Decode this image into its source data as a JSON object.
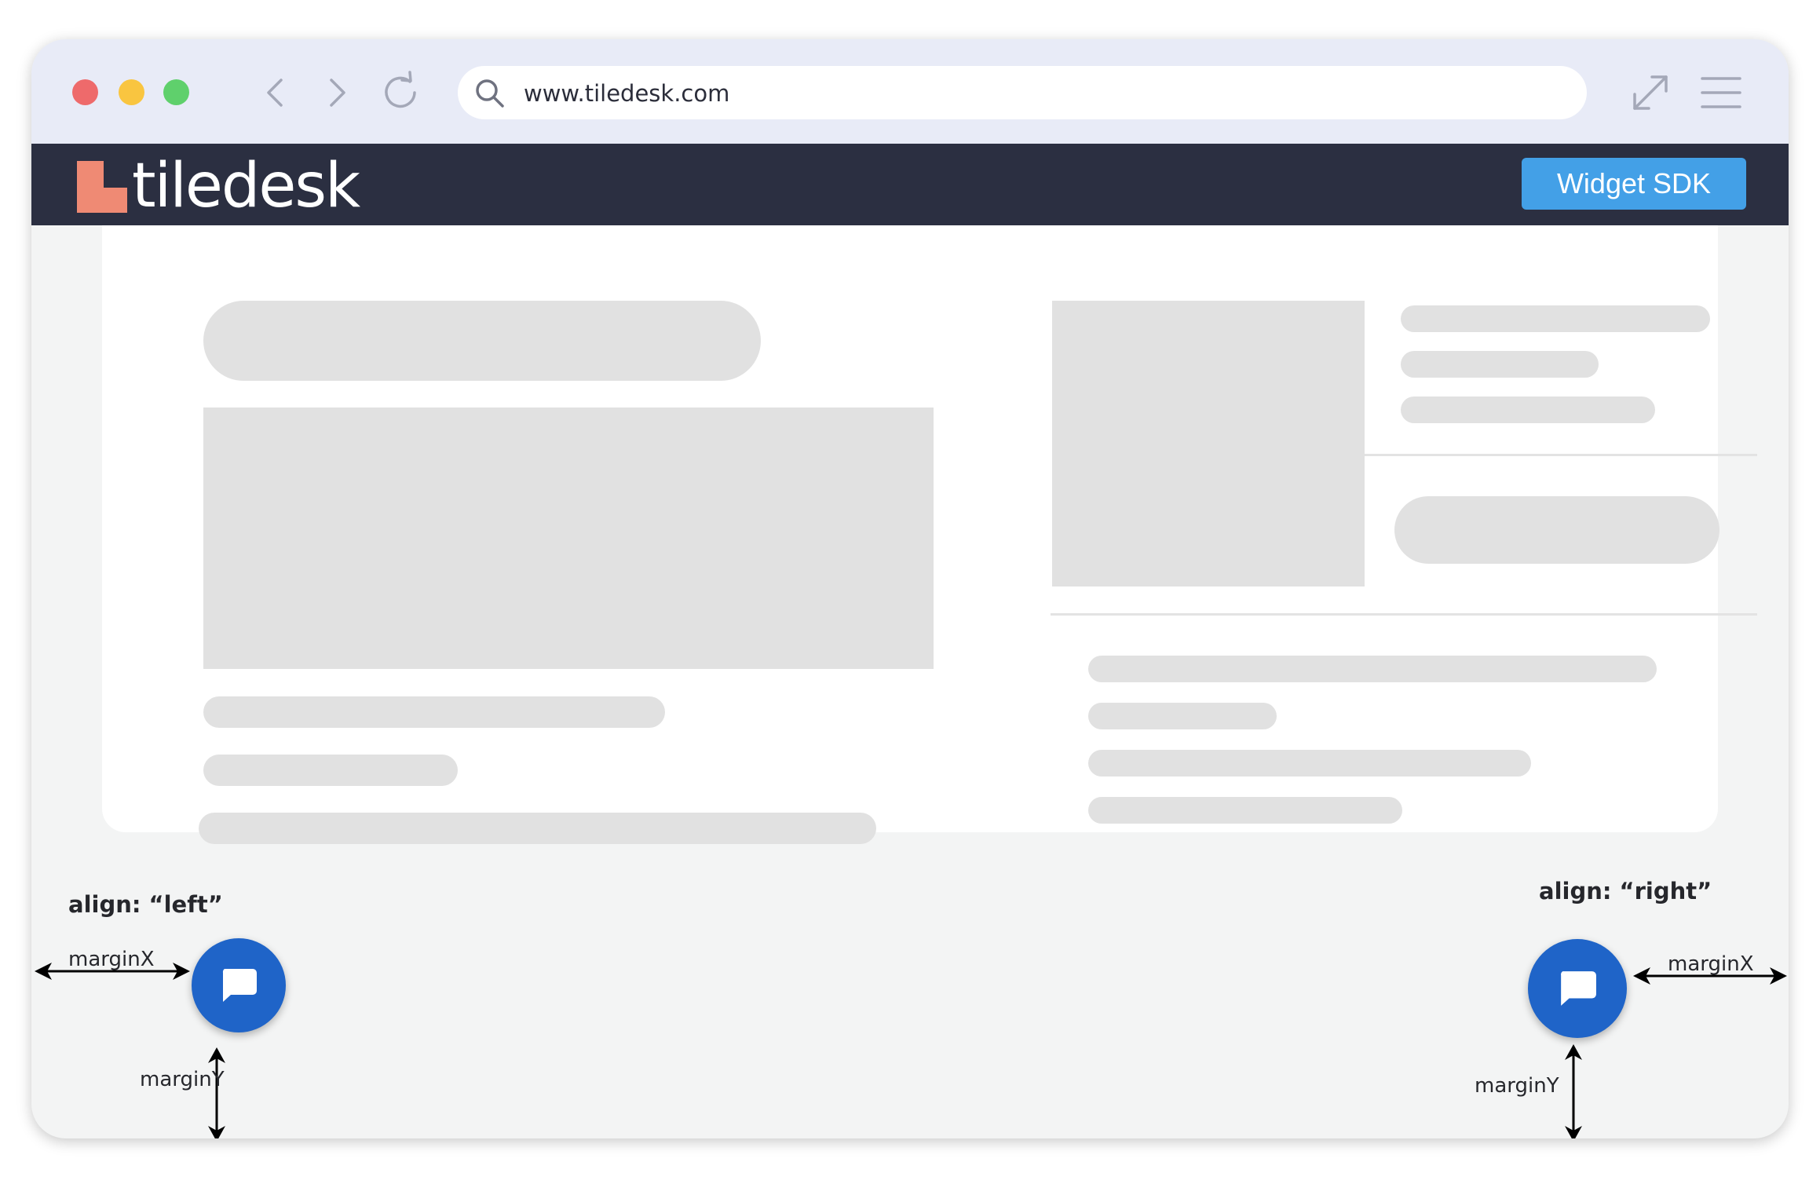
{
  "browser": {
    "url": "www.tiledesk.com",
    "icons": [
      "close-dot",
      "minimize-dot",
      "maximize-dot",
      "back-icon",
      "forward-icon",
      "reload-icon",
      "search-icon",
      "expand-icon",
      "menu-icon"
    ]
  },
  "header": {
    "logo_text": "tiledesk",
    "button_label": "Widget SDK",
    "colors": {
      "bar": "#2b2f41",
      "button": "#43a0e7",
      "logo_mark": "#ef8a74"
    }
  },
  "launchers": {
    "left": {
      "align_label": "align: “left”",
      "margin_x_label": "marginX",
      "margin_y_label": "marginY"
    },
    "right": {
      "align_label": "align: “right”",
      "margin_x_label": "marginX",
      "margin_y_label": "marginY"
    },
    "color": "#1f64c8",
    "icon": "chat-bubble-icon"
  }
}
